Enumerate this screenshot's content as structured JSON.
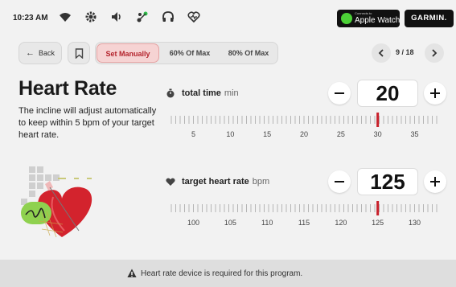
{
  "status": {
    "time": "10:23 AM",
    "icons": [
      "wifi-icon",
      "settings-icon",
      "volume-icon",
      "connection-icon",
      "headphones-icon",
      "heart-monitor-icon"
    ]
  },
  "badges": {
    "apple_watch_small": "Connects to",
    "apple_watch": "Apple Watch",
    "garmin": "GARMIN."
  },
  "nav": {
    "back": "Back",
    "modes": [
      "Set Manually",
      "60% Of Max",
      "80% Of Max"
    ],
    "active_mode": 0,
    "page": "9 / 18"
  },
  "intro": {
    "title": "Heart Rate",
    "description": "The incline will adjust automatically to keep within 5 bpm of your target heart rate."
  },
  "total_time": {
    "label": "total time",
    "unit": "min",
    "value": "20",
    "slider_value": 30,
    "scale": [
      "5",
      "10",
      "15",
      "20",
      "25",
      "30",
      "35"
    ]
  },
  "target_hr": {
    "label": "target heart rate",
    "unit": "bpm",
    "value": "125",
    "slider_value": 125,
    "scale": [
      "100",
      "105",
      "110",
      "115",
      "120",
      "125",
      "130"
    ]
  },
  "footer": {
    "message": "Heart rate device is required for this program."
  },
  "colors": {
    "accent": "#b4232c",
    "marker": "#c8202a",
    "heart": "#d3232d",
    "apple_watch_green": "#4cd137"
  }
}
